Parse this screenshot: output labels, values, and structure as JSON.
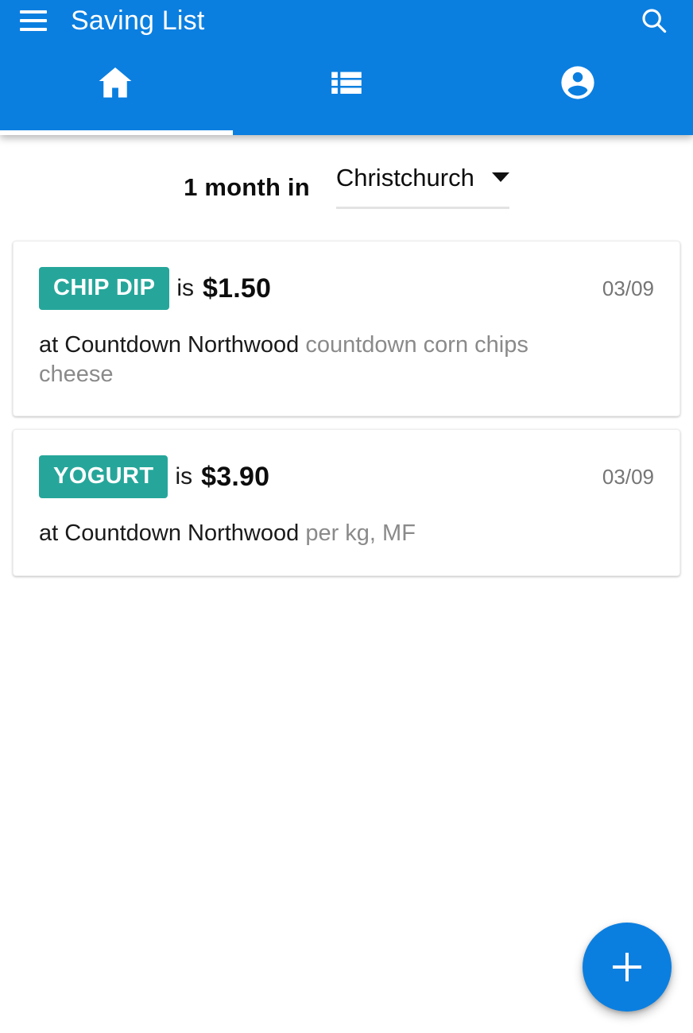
{
  "appbar": {
    "title": "Saving List",
    "menu_icon": "hamburger-menu-icon",
    "search_icon": "search-icon",
    "background_color": "#0B7FE0"
  },
  "tabs": [
    {
      "id": "home",
      "icon": "home-icon",
      "active": true,
      "label": "Home"
    },
    {
      "id": "list",
      "icon": "list-view-icon",
      "active": false,
      "label": "List"
    },
    {
      "id": "account",
      "icon": "account-circle-icon",
      "active": false,
      "label": "Account"
    }
  ],
  "filter": {
    "label": "1 month in",
    "selected_location": "Christchurch",
    "caret_icon": "chevron-down-icon"
  },
  "cards": [
    {
      "product": "CHIP DIP",
      "is_word": "is",
      "price": "$1.50",
      "date": "03/09",
      "store_prefix": "at ",
      "store": "Countdown Northwood",
      "note": "countdown corn chips cheese",
      "badge_color": "#26A69A"
    },
    {
      "product": "YOGURT",
      "is_word": "is",
      "price": "$3.90",
      "date": "03/09",
      "store_prefix": "at ",
      "store": "Countdown Northwood",
      "note": "per kg, MF",
      "badge_color": "#26A69A"
    }
  ],
  "fab": {
    "icon": "plus-icon",
    "label": "Add",
    "color": "#0B7FE0"
  }
}
